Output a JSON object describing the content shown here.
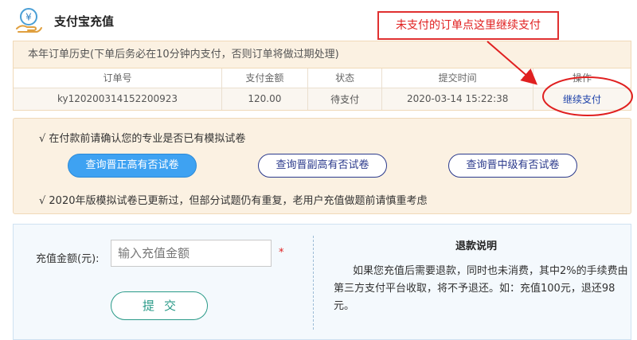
{
  "header": {
    "title": "支付宝充值",
    "logo_icon": "yen-hand-icon"
  },
  "history": {
    "notice": "本年订单历史(下单后务必在10分钟内支付，否则订单将做过期处理)",
    "columns": [
      "订单号",
      "支付金额",
      "状态",
      "提交时间",
      "操作"
    ],
    "rows": [
      {
        "order_no": "ky120200314152200923",
        "amount": "120.00",
        "status": "待支付",
        "submitted": "2020-03-14 15:22:38",
        "action": "继续支付"
      }
    ]
  },
  "annotation": {
    "callout": "未支付的订单点这里继续支付",
    "color": "#e02020"
  },
  "notice_panel": {
    "line1": "√ 在付款前请确认您的专业是否已有模拟试卷",
    "buttons": [
      "查询晋正高有否试卷",
      "查询晋副高有否试卷",
      "查询晋中级有否试卷"
    ],
    "line2": "√ 2020年版模拟试卷已更新过，但部分试题仍有重复，老用户充值做题前请慎重考虑"
  },
  "recharge": {
    "amount_label": "充值金额(元):",
    "amount_placeholder": "输入充值金额",
    "amount_value": "",
    "required_mark": "*",
    "submit_label": "提交"
  },
  "refund": {
    "title": "退款说明",
    "text": "如果您充值后需要退款，同时也未消费，其中2%的手续费由第三方支付平台收取，将不予退还。如：充值100元，退还98元。"
  },
  "colors": {
    "primary_button": "#3ea2f2",
    "outline_button": "#2b3a8c",
    "submit_button": "#2a9a88",
    "history_bg": "#fbf1e2",
    "recharge_bg": "#f4f9fd"
  }
}
